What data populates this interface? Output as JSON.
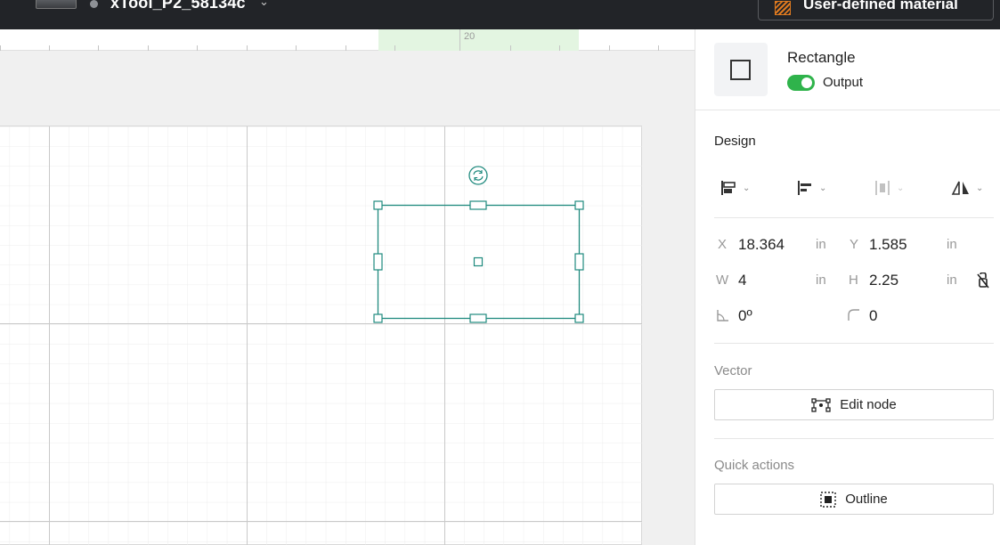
{
  "topbar": {
    "device_name": "xTool_P2_58134c",
    "material_label": "User-defined material"
  },
  "ruler": {
    "label": "20"
  },
  "object": {
    "type_title": "Rectangle",
    "output_label": "Output",
    "output_enabled": true
  },
  "design": {
    "title": "Design",
    "x_label": "X",
    "x_value": "18.364",
    "x_unit": "in",
    "y_label": "Y",
    "y_value": "1.585",
    "y_unit": "in",
    "w_label": "W",
    "w_value": "4",
    "w_unit": "in",
    "h_label": "H",
    "h_value": "2.25",
    "h_unit": "in",
    "rotation_value": "0º",
    "corner_value": "0"
  },
  "vector": {
    "title": "Vector",
    "edit_node_label": "Edit node"
  },
  "quick_actions": {
    "title": "Quick actions",
    "outline_label": "Outline"
  },
  "colors": {
    "accent_toggle": "#2fb34b",
    "selection": "#1f8a7e",
    "material_icon": "#e07a1f",
    "topbar_bg": "#222428"
  },
  "icons": {
    "align": "align-objects-icon",
    "align_left": "align-left-icon",
    "distribute": "distribute-icon",
    "flip": "flip-icon",
    "lock": "aspect-unlock-icon",
    "rotation": "rotation-angle-icon",
    "corner": "corner-radius-icon",
    "edit_node": "edit-node-icon",
    "outline": "outline-icon",
    "rotate_handle": "rotate-handle-icon"
  }
}
